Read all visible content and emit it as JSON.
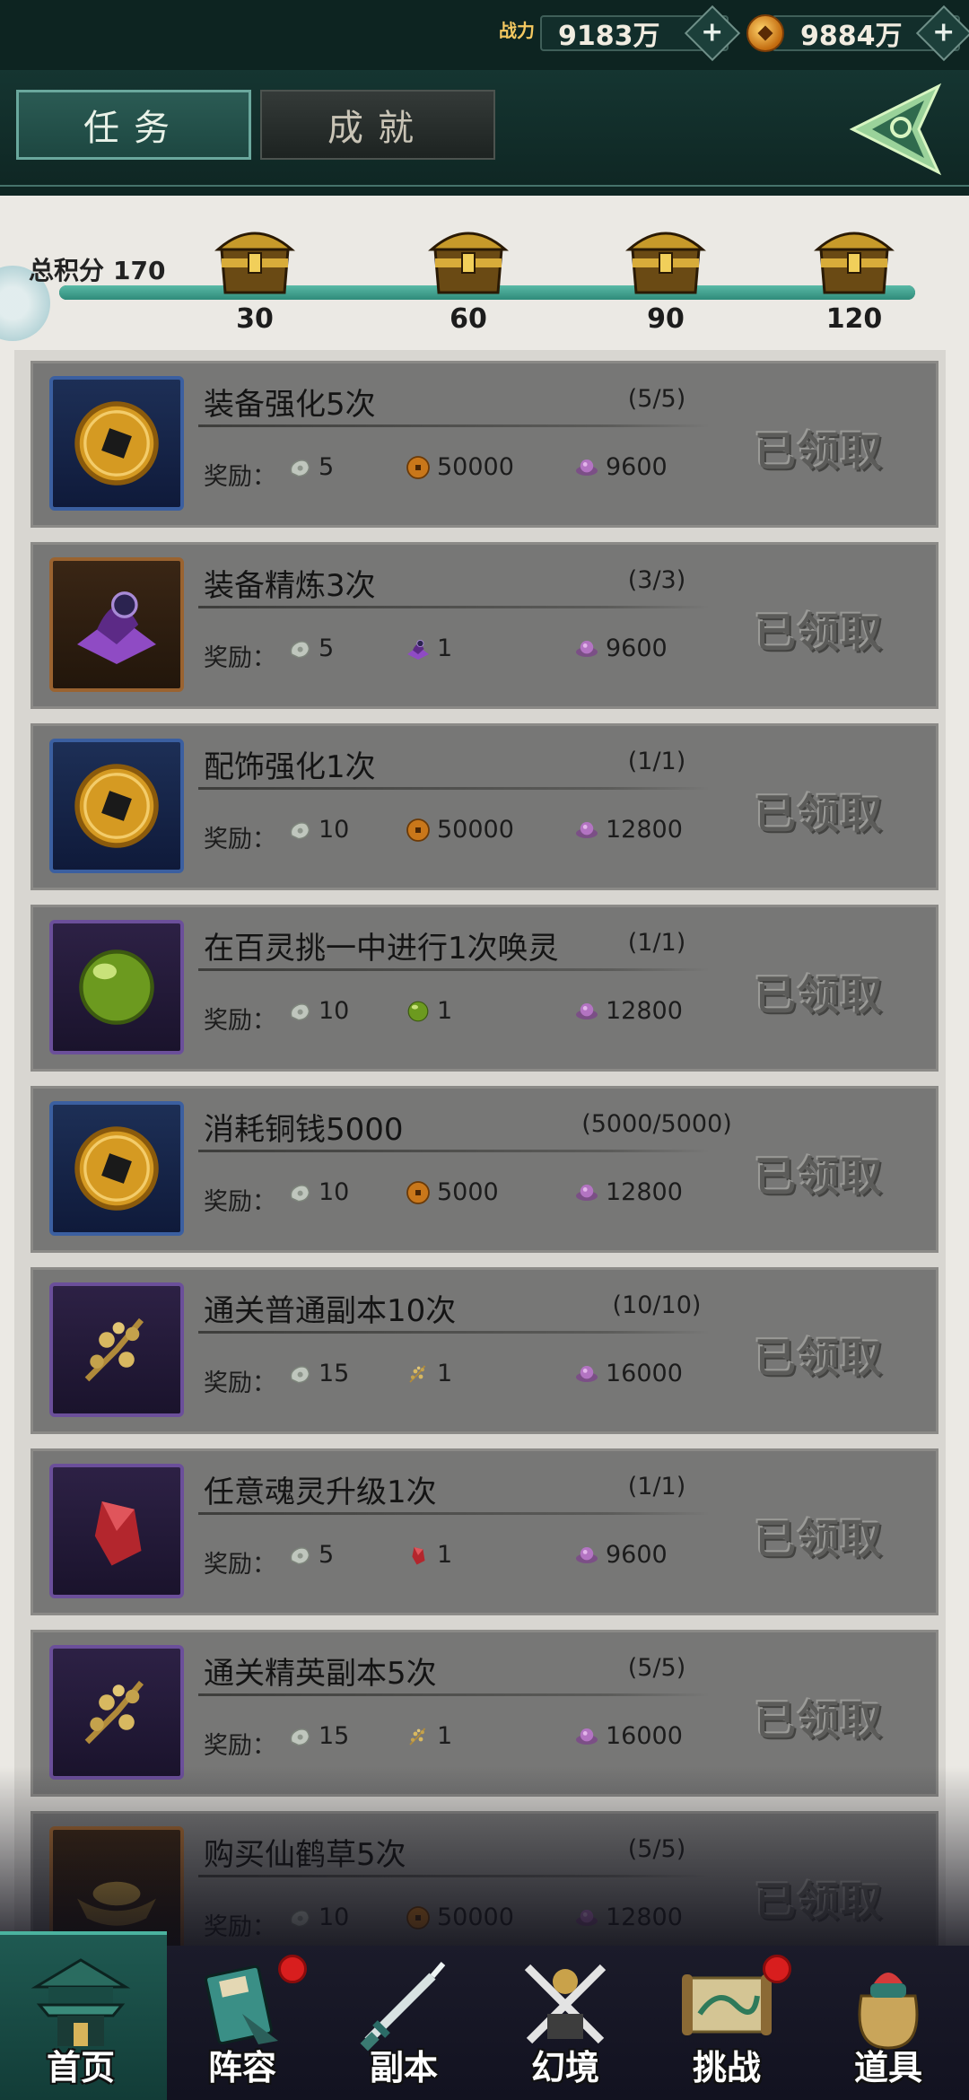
{
  "resources": {
    "power_label": "战力",
    "power_value": "9183万",
    "coin_value": "9884万",
    "plus": "+"
  },
  "tabs": {
    "task": "任务",
    "achievement": "成就"
  },
  "progress": {
    "label": "总积分",
    "score": "170",
    "max": "120",
    "fill_fraction": 1.0,
    "milestones": [
      "30",
      "60",
      "90",
      "120"
    ]
  },
  "reward_prefix": "奖励：",
  "claimed_text": "已领取",
  "tasks": [
    {
      "title": "装备强化5次",
      "count": "(5/5)",
      "icon": "copper-coin-icon",
      "frame": "blue",
      "rewards": [
        {
          "icon": "jade-icon",
          "value": "5"
        },
        {
          "icon": "coin-icon",
          "value": "50000"
        },
        {
          "icon": "spirit-gem-icon",
          "value": "9600"
        }
      ]
    },
    {
      "title": "装备精炼3次",
      "count": "(3/3)",
      "icon": "refine-stone-icon",
      "frame": "orange",
      "rewards": [
        {
          "icon": "jade-icon",
          "value": "5"
        },
        {
          "icon": "refine-stone-icon",
          "value": "1"
        },
        {
          "icon": "spirit-gem-icon",
          "value": "9600"
        }
      ]
    },
    {
      "title": "配饰强化1次",
      "count": "(1/1)",
      "icon": "copper-coin-icon",
      "frame": "blue",
      "rewards": [
        {
          "icon": "jade-icon",
          "value": "10"
        },
        {
          "icon": "coin-icon",
          "value": "50000"
        },
        {
          "icon": "spirit-gem-icon",
          "value": "12800"
        }
      ]
    },
    {
      "title": "在百灵挑一中进行1次唤灵",
      "count": "(1/1)",
      "icon": "green-orb-icon",
      "frame": "purple",
      "rewards": [
        {
          "icon": "jade-icon",
          "value": "10"
        },
        {
          "icon": "green-orb-icon",
          "value": "1"
        },
        {
          "icon": "spirit-gem-icon",
          "value": "12800"
        }
      ]
    },
    {
      "title": "消耗铜钱5000",
      "count": "(5000/5000)",
      "icon": "copper-coin-icon",
      "frame": "blue",
      "rewards": [
        {
          "icon": "jade-icon",
          "value": "10"
        },
        {
          "icon": "coin-icon",
          "value": "5000"
        },
        {
          "icon": "spirit-gem-icon",
          "value": "12800"
        }
      ]
    },
    {
      "title": "通关普通副本10次",
      "count": "(10/10)",
      "icon": "herb-icon",
      "frame": "purple",
      "rewards": [
        {
          "icon": "jade-icon",
          "value": "15"
        },
        {
          "icon": "herb-icon",
          "value": "1"
        },
        {
          "icon": "spirit-gem-icon",
          "value": "16000"
        }
      ]
    },
    {
      "title": "任意魂灵升级1次",
      "count": "(1/1)",
      "icon": "red-crystal-icon",
      "frame": "purple",
      "rewards": [
        {
          "icon": "jade-icon",
          "value": "5"
        },
        {
          "icon": "red-crystal-icon",
          "value": "1"
        },
        {
          "icon": "spirit-gem-icon",
          "value": "9600"
        }
      ]
    },
    {
      "title": "通关精英副本5次",
      "count": "(5/5)",
      "icon": "herb-icon",
      "frame": "purple",
      "rewards": [
        {
          "icon": "jade-icon",
          "value": "15"
        },
        {
          "icon": "herb-icon",
          "value": "1"
        },
        {
          "icon": "spirit-gem-icon",
          "value": "16000"
        }
      ]
    },
    {
      "title": "购买仙鹤草5次",
      "count": "(5/5)",
      "icon": "gold-ingot-icon",
      "frame": "orange",
      "rewards": [
        {
          "icon": "jade-icon",
          "value": "10"
        },
        {
          "icon": "coin-icon",
          "value": "50000"
        },
        {
          "icon": "spirit-gem-icon",
          "value": "12800"
        }
      ]
    }
  ],
  "nav": [
    {
      "label": "首页",
      "icon": "home-pavilion-icon",
      "dot": false,
      "active": true
    },
    {
      "label": "阵容",
      "icon": "lineup-book-icon",
      "dot": true,
      "active": false
    },
    {
      "label": "副本",
      "icon": "sword-icon",
      "dot": false,
      "active": false
    },
    {
      "label": "幻境",
      "icon": "crossed-swords-icon",
      "dot": false,
      "active": false
    },
    {
      "label": "挑战",
      "icon": "scroll-map-icon",
      "dot": true,
      "active": false
    },
    {
      "label": "道具",
      "icon": "item-bag-icon",
      "dot": false,
      "active": false
    }
  ],
  "colors": {
    "accent_teal": "#4bb39f",
    "badge_red": "#d81e1e",
    "panel_bg": "#ebe9e4"
  }
}
